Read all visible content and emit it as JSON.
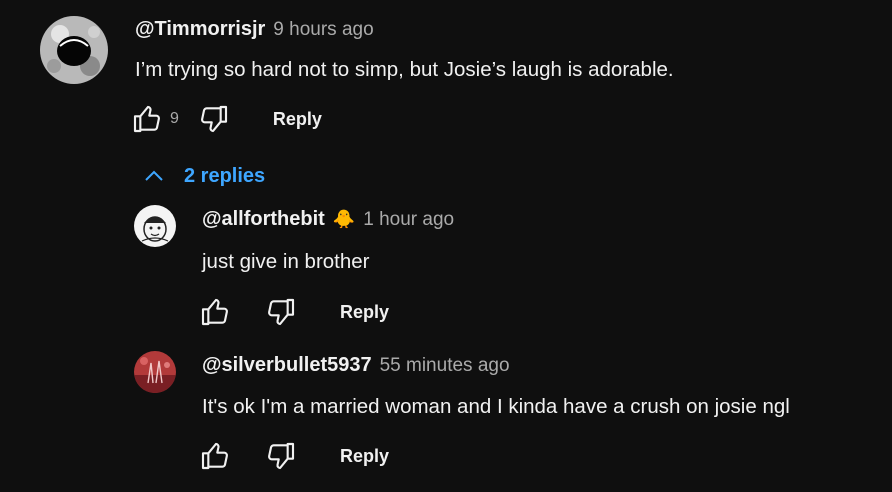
{
  "comments": [
    {
      "author": "@Timmorrisjr",
      "time": "9 hours ago",
      "text": "I’m trying so hard not to simp, but Josie’s laugh is adorable.",
      "likes": "9",
      "reply_label": "Reply"
    }
  ],
  "replies_toggle": {
    "label": "2 replies",
    "icon": "chevron-up-icon",
    "color": "#3ea6ff"
  },
  "replies": [
    {
      "author": "@allforthebit",
      "badge": "🐥",
      "time": "1 hour ago",
      "text": "just give in brother",
      "likes": "",
      "reply_label": "Reply"
    },
    {
      "author": "@silverbullet5937",
      "time": "55 minutes ago",
      "text": "It's ok I'm a married woman and I kinda have a crush on josie ngl",
      "likes": "",
      "reply_label": "Reply"
    }
  ],
  "colors": {
    "background": "#0f0f0f",
    "primary_text": "#f1f1f1",
    "secondary_text": "#aaaaaa",
    "link": "#3ea6ff"
  }
}
